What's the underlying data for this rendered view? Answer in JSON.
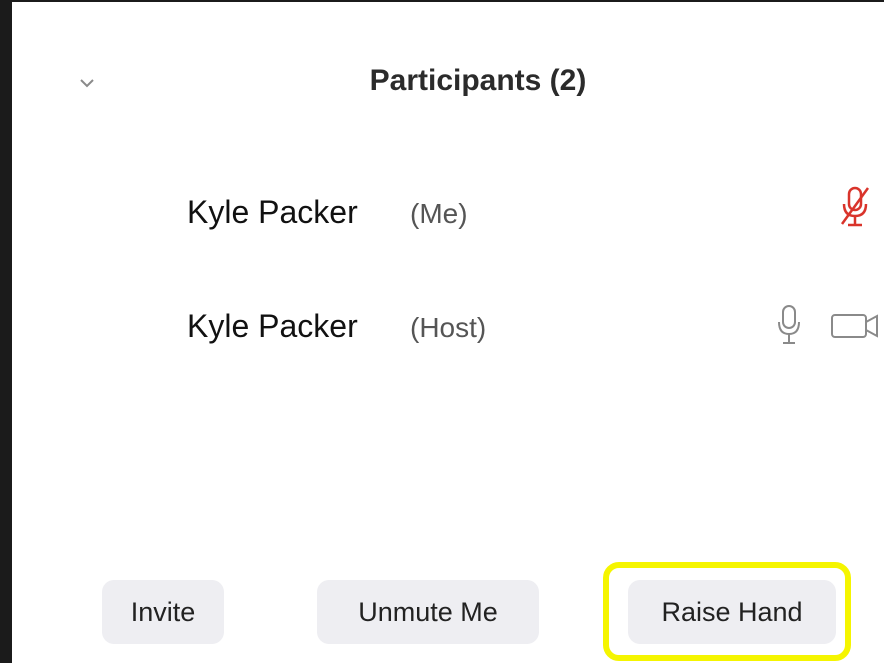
{
  "panel": {
    "title": "Participants (2)",
    "collapse_icon": "chevron-down-icon"
  },
  "participants": [
    {
      "name": "Kyle Packer",
      "role": "(Me)",
      "audio": "muted",
      "audio_icon": "mic-muted-icon",
      "audio_color": "#d9342b"
    },
    {
      "name": "Kyle Packer",
      "role": "(Host)",
      "audio": "unmuted",
      "audio_icon": "mic-icon",
      "video_icon": "video-camera-icon"
    }
  ],
  "footer": {
    "invite_label": "Invite",
    "unmute_label": "Unmute Me",
    "raise_hand_label": "Raise Hand"
  },
  "highlight": {
    "target": "raise-hand-button",
    "color": "#f5f500"
  }
}
